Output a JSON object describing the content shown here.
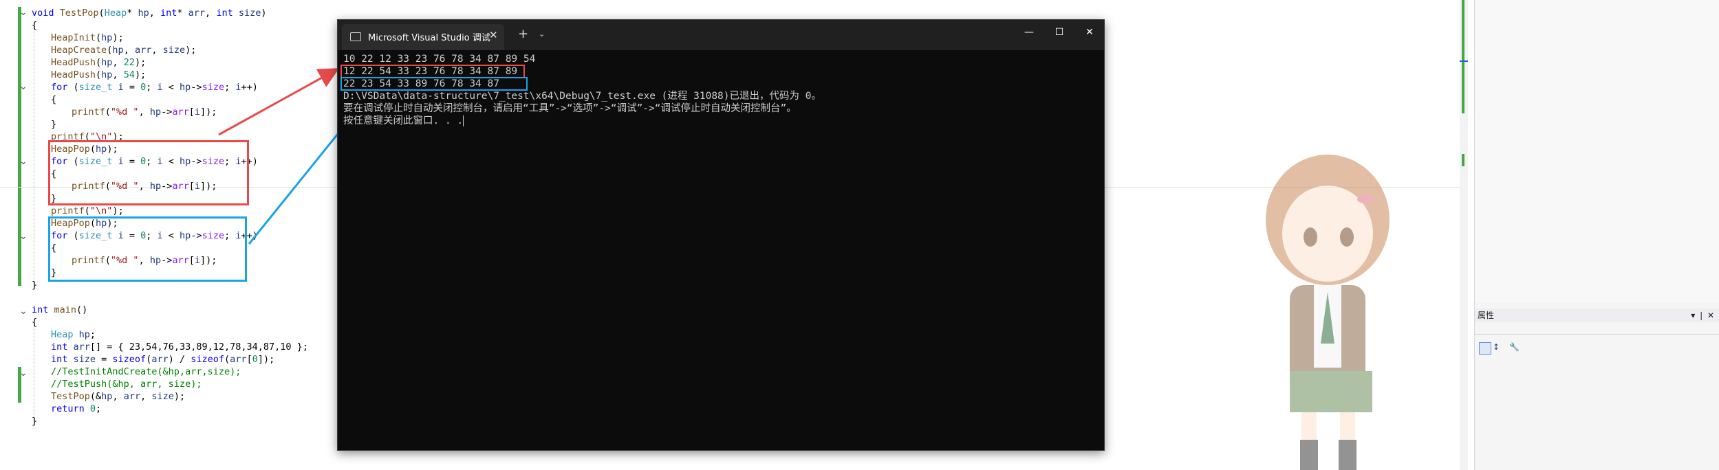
{
  "editor": {
    "code": [
      {
        "tokens": [
          [
            "kw",
            "void "
          ],
          [
            "fn",
            "TestPop"
          ],
          [
            "",
            "("
          ],
          [
            "ty",
            "Heap"
          ],
          [
            "",
            "* "
          ],
          [
            "va",
            "hp"
          ],
          [
            "",
            ", "
          ],
          [
            "kw",
            "int"
          ],
          [
            "",
            "* "
          ],
          [
            "va",
            "arr"
          ],
          [
            "",
            ", "
          ],
          [
            "kw",
            "int "
          ],
          [
            "va",
            "size"
          ],
          [
            "",
            ")"
          ]
        ]
      },
      {
        "tokens": [
          [
            "",
            "{"
          ]
        ]
      },
      {
        "tokens": [
          [
            "",
            ""
          ]
        ]
      },
      {
        "tokens": [
          [
            "fn",
            "HeapInit"
          ],
          [
            "",
            "("
          ],
          [
            "va",
            "hp"
          ],
          [
            "",
            ");"
          ]
        ]
      },
      {
        "tokens": [
          [
            "fn",
            "HeapCreate"
          ],
          [
            "",
            "("
          ],
          [
            "va",
            "hp"
          ],
          [
            "",
            ", "
          ],
          [
            "va",
            "arr"
          ],
          [
            "",
            ", "
          ],
          [
            "va",
            "size"
          ],
          [
            "",
            ");"
          ]
        ]
      },
      {
        "tokens": [
          [
            "fn",
            "HeadPush"
          ],
          [
            "",
            "("
          ],
          [
            "va",
            "hp"
          ],
          [
            "",
            ", "
          ],
          [
            "num",
            "22"
          ],
          [
            "",
            ");"
          ]
        ]
      },
      {
        "tokens": [
          [
            "fn",
            "HeadPush"
          ],
          [
            "",
            "("
          ],
          [
            "va",
            "hp"
          ],
          [
            "",
            ", "
          ],
          [
            "num",
            "54"
          ],
          [
            "",
            ");"
          ]
        ]
      },
      {
        "tokens": [
          [
            "kw",
            "for "
          ],
          [
            "",
            "("
          ],
          [
            "ty",
            "size_t "
          ],
          [
            "va",
            "i"
          ],
          [
            "",
            " = "
          ],
          [
            "num",
            "0"
          ],
          [
            "",
            "; "
          ],
          [
            "va",
            "i"
          ],
          [
            "",
            " < "
          ],
          [
            "va",
            "hp"
          ],
          [
            "",
            "->"
          ],
          [
            "mb",
            "size"
          ],
          [
            "",
            "; "
          ],
          [
            "va",
            "i"
          ],
          [
            "",
            "++)"
          ]
        ]
      },
      {
        "tokens": [
          [
            "",
            "{"
          ]
        ]
      },
      {
        "tokens": [
          [
            "fn",
            "printf"
          ],
          [
            "",
            "("
          ],
          [
            "str",
            "\"%d \""
          ],
          [
            "",
            ", "
          ],
          [
            "va",
            "hp"
          ],
          [
            "",
            "->"
          ],
          [
            "mb",
            "arr"
          ],
          [
            "",
            "["
          ],
          [
            "va",
            "i"
          ],
          [
            "",
            "]);"
          ]
        ]
      },
      {
        "tokens": [
          [
            "",
            "}"
          ]
        ]
      },
      {
        "tokens": [
          [
            "fn",
            "printf"
          ],
          [
            "",
            "("
          ],
          [
            "str",
            "\"\\n\""
          ],
          [
            "",
            ");"
          ]
        ]
      },
      {
        "tokens": [
          [
            "fn",
            "HeapPop"
          ],
          [
            "",
            "("
          ],
          [
            "va",
            "hp"
          ],
          [
            "",
            ");"
          ]
        ]
      },
      {
        "tokens": [
          [
            "kw",
            "for "
          ],
          [
            "",
            "("
          ],
          [
            "ty",
            "size_t "
          ],
          [
            "va",
            "i"
          ],
          [
            "",
            " = "
          ],
          [
            "num",
            "0"
          ],
          [
            "",
            "; "
          ],
          [
            "va",
            "i"
          ],
          [
            "",
            " < "
          ],
          [
            "va",
            "hp"
          ],
          [
            "",
            "->"
          ],
          [
            "mb",
            "size"
          ],
          [
            "",
            "; "
          ],
          [
            "va",
            "i"
          ],
          [
            "",
            "++)"
          ]
        ]
      },
      {
        "tokens": [
          [
            "",
            "{"
          ]
        ]
      },
      {
        "tokens": [
          [
            "fn",
            "printf"
          ],
          [
            "",
            "("
          ],
          [
            "str",
            "\"%d \""
          ],
          [
            "",
            ", "
          ],
          [
            "va",
            "hp"
          ],
          [
            "",
            "->"
          ],
          [
            "mb",
            "arr"
          ],
          [
            "",
            "["
          ],
          [
            "va",
            "i"
          ],
          [
            "",
            "]);"
          ]
        ]
      },
      {
        "tokens": [
          [
            "",
            "}"
          ]
        ]
      },
      {
        "tokens": [
          [
            "fn",
            "printf"
          ],
          [
            "",
            "("
          ],
          [
            "str",
            "\"\\n\""
          ],
          [
            "",
            ");"
          ]
        ]
      },
      {
        "tokens": [
          [
            "fn",
            "HeapPop"
          ],
          [
            "",
            "("
          ],
          [
            "va",
            "hp"
          ],
          [
            "",
            ");"
          ]
        ]
      },
      {
        "tokens": [
          [
            "kw",
            "for "
          ],
          [
            "",
            "("
          ],
          [
            "ty",
            "size_t "
          ],
          [
            "va",
            "i"
          ],
          [
            "",
            " = "
          ],
          [
            "num",
            "0"
          ],
          [
            "",
            "; "
          ],
          [
            "va",
            "i"
          ],
          [
            "",
            " < "
          ],
          [
            "va",
            "hp"
          ],
          [
            "",
            "->"
          ],
          [
            "mb",
            "size"
          ],
          [
            "",
            "; "
          ],
          [
            "va",
            "i"
          ],
          [
            "",
            "++)"
          ]
        ]
      },
      {
        "tokens": [
          [
            "",
            "{"
          ]
        ]
      },
      {
        "tokens": [
          [
            "fn",
            "printf"
          ],
          [
            "",
            "("
          ],
          [
            "str",
            "\"%d \""
          ],
          [
            "",
            ", "
          ],
          [
            "va",
            "hp"
          ],
          [
            "",
            "->"
          ],
          [
            "mb",
            "arr"
          ],
          [
            "",
            "["
          ],
          [
            "va",
            "i"
          ],
          [
            "",
            "]);"
          ]
        ]
      },
      {
        "tokens": [
          [
            "",
            "}"
          ]
        ]
      },
      {
        "tokens": [
          [
            "",
            "}"
          ]
        ]
      },
      {
        "tokens": [
          [
            "",
            ""
          ]
        ]
      },
      {
        "tokens": [
          [
            "kw",
            "int "
          ],
          [
            "fn",
            "main"
          ],
          [
            "",
            "()"
          ]
        ]
      },
      {
        "tokens": [
          [
            "",
            "{"
          ]
        ]
      },
      {
        "tokens": [
          [
            "",
            ""
          ]
        ]
      },
      {
        "tokens": [
          [
            "ty",
            "Heap "
          ],
          [
            "va",
            "hp"
          ],
          [
            "",
            ";"
          ]
        ]
      },
      {
        "tokens": [
          [
            "kw",
            "int "
          ],
          [
            "va",
            "arr"
          ],
          [
            "",
            "[] = { 23,54,76,33,89,12,78,34,87,10 };"
          ]
        ]
      },
      {
        "tokens": [
          [
            "kw",
            "int "
          ],
          [
            "va",
            "size"
          ],
          [
            "",
            " = "
          ],
          [
            "kw",
            "sizeof"
          ],
          [
            "",
            "("
          ],
          [
            "va",
            "arr"
          ],
          [
            "",
            ") / "
          ],
          [
            "kw",
            "sizeof"
          ],
          [
            "",
            "("
          ],
          [
            "va",
            "arr"
          ],
          [
            "",
            "["
          ],
          [
            "num",
            "0"
          ],
          [
            "",
            "]);"
          ]
        ]
      },
      {
        "tokens": [
          [
            "cm",
            "//TestInitAndCreate(&hp,arr,size);"
          ]
        ]
      },
      {
        "tokens": [
          [
            "cm",
            "//TestPush(&hp, arr, size);"
          ]
        ]
      },
      {
        "tokens": [
          [
            "fn",
            "TestPop"
          ],
          [
            "",
            "(&"
          ],
          [
            "va",
            "hp"
          ],
          [
            "",
            ", "
          ],
          [
            "va",
            "arr"
          ],
          [
            "",
            ", "
          ],
          [
            "va",
            "size"
          ],
          [
            "",
            ");"
          ]
        ]
      },
      {
        "tokens": [
          [
            "kw",
            "return "
          ],
          [
            "num",
            "0"
          ],
          [
            "",
            ";"
          ]
        ]
      },
      {
        "tokens": [
          [
            "",
            "}"
          ]
        ]
      }
    ]
  },
  "console": {
    "tab_title": "Microsoft Visual Studio 调试",
    "new_tab": "+",
    "dropdown": "⌄",
    "close_tab": "✕",
    "minimize": "—",
    "maximize": "☐",
    "close_window": "✕",
    "lines": [
      "10 22 12 33 23 76 78 34 87 89 54",
      "12 22 54 33 23 76 78 34 87 89",
      "22 23 54 33 89 76 78 34 87",
      "D:\\VSData\\data-structure\\7_test\\x64\\Debug\\7_test.exe (进程 31088)已退出，代码为 0。",
      "要在调试停止时自动关闭控制台，请启用“工具”->“选项”->“调试”->“调试停止时自动关闭控制台”。",
      "按任意键关闭此窗口. . ."
    ]
  },
  "properties": {
    "title": "属性",
    "pin": "▾ ❘ ✕"
  },
  "colors": {
    "red_annotation": "#e84a4a",
    "blue_annotation": "#1aa3e8",
    "green_change": "#44a844"
  }
}
